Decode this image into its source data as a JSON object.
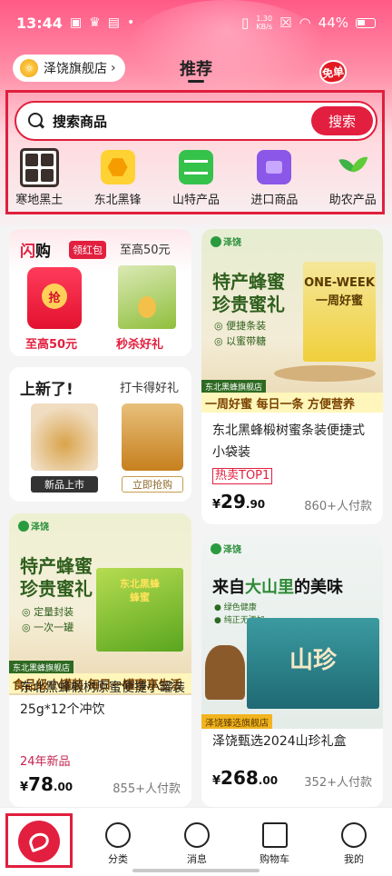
{
  "status_bar": {
    "time": "13:44",
    "net_speed": "1.30\nKB/s",
    "battery": "44%"
  },
  "header": {
    "store_name": "泽饶旗舰店",
    "tab_title": "推荐",
    "free_badge": "免单"
  },
  "search": {
    "placeholder": "搜索商品",
    "button": "搜索"
  },
  "categories": [
    {
      "label": "寒地黑土",
      "icon": "grid-icon"
    },
    {
      "label": "东北黑锋",
      "icon": "honeycomb-icon"
    },
    {
      "label": "山特产品",
      "icon": "mountain-icon"
    },
    {
      "label": "进口商品",
      "icon": "import-box-icon"
    },
    {
      "label": "助农产品",
      "icon": "sprout-icon"
    }
  ],
  "flash_sale": {
    "title_a": "闪",
    "title_b": "购",
    "tag": "领红包",
    "upto": "至高50元",
    "packet_char": "抢",
    "left_label": "至高50元",
    "right_label": "秒杀好礼"
  },
  "new_arrivals": {
    "title": "上新了!",
    "subtitle": "打卡得好礼",
    "btn_left": "新品上市",
    "btn_right": "立即抢购"
  },
  "products": [
    {
      "brand": "泽饶",
      "hero": "特产蜂蜜\n珍贵蜜礼",
      "bullets": "◎ 便捷条装\n◎ 以蜜带糖",
      "box_text": "ONE-WEEK\n一周好蜜",
      "shop_tag": "东北黑蜂旗舰店",
      "strip": "一周好蜜 每日一条 方便营养",
      "title": "东北黑蜂椴树蜜条装便捷式小袋装",
      "badge": "热卖TOP1",
      "price_yen": "¥",
      "price_int": "29",
      "price_dec": ".90",
      "paid": "860+人付款"
    },
    {
      "brand": "泽饶",
      "hero": "特产蜂蜜\n珍贵蜜礼",
      "bullets": "◎ 定量封装\n◎ 一次一罐",
      "box_text": "东北黑蜂\n蜂蜜",
      "shop_tag": "东北黑蜂旗舰店",
      "strip": "食品级小罐装 每日一罐蜜享生活",
      "title": "东北黑蜂椴树原蜜便捷小罐装25g*12个冲饮",
      "badge": "24年新品",
      "price_yen": "¥",
      "price_int": "78",
      "price_dec": ".00",
      "paid": "855+人付款"
    },
    {
      "brand": "泽饶",
      "hero_a": "来自",
      "hero_b": "大山里",
      "hero_c": "的",
      "hero_d": "美味",
      "bullets": "● 绿色健康\n● 纯正无添加",
      "box_text": "山珍",
      "shop_tag": "泽饶臻选旗舰店",
      "title": "泽饶甄选2024山珍礼盒",
      "price_yen": "¥",
      "price_int": "268",
      "price_dec": ".00",
      "paid": "352+人付款"
    }
  ],
  "bottom_nav": [
    {
      "label": "分类",
      "icon": "category-icon"
    },
    {
      "label": "消息",
      "icon": "message-icon"
    },
    {
      "label": "购物车",
      "icon": "cart-icon"
    },
    {
      "label": "我的",
      "icon": "profile-icon"
    }
  ]
}
